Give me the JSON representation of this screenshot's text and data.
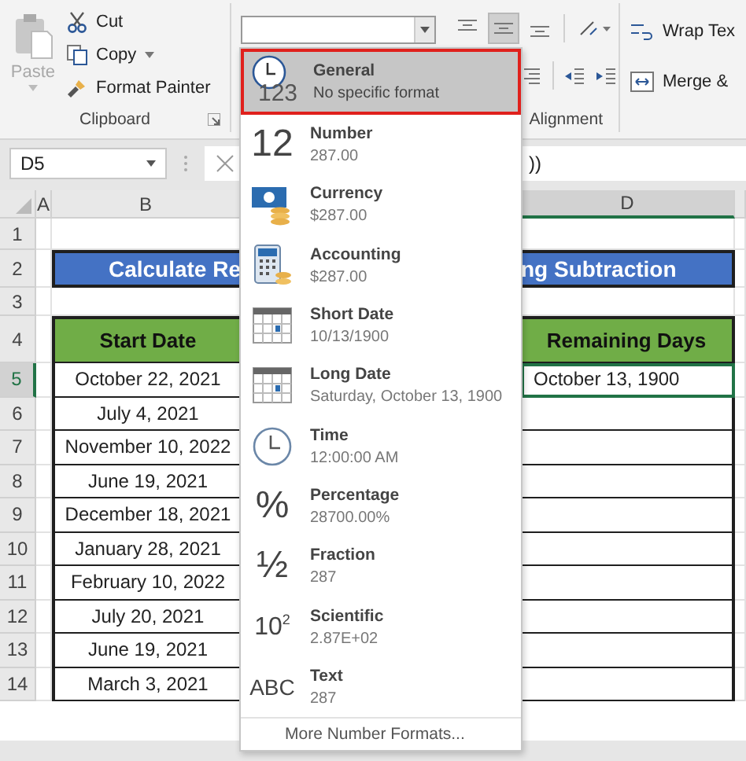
{
  "ribbon": {
    "clipboard": {
      "paste": {
        "label": "Paste",
        "disabled": true
      },
      "commands": [
        {
          "label": "Cut",
          "kind": "cut",
          "caret": false
        },
        {
          "label": "Copy",
          "kind": "copy",
          "caret": true
        },
        {
          "label": "Format Painter",
          "kind": "painter",
          "caret": false
        }
      ],
      "group_label": "Clipboard"
    },
    "alignment": {
      "vertical_buttons": [
        {
          "kind": "top",
          "selected": false
        },
        {
          "kind": "middle",
          "selected": true
        },
        {
          "kind": "bottom",
          "selected": false
        }
      ],
      "wrap_label": "Wrap Tex",
      "merge_label": "Merge &",
      "group_label": "Alignment"
    }
  },
  "formula_bar": {
    "name_box": "D5",
    "formula_visible": "))"
  },
  "columns": [
    {
      "label": "A",
      "selected": false
    },
    {
      "label": "B",
      "selected": false
    },
    {
      "label": "D",
      "selected": true
    }
  ],
  "rows": [
    {
      "number": "1",
      "selected": false
    },
    {
      "number": "2",
      "selected": false
    },
    {
      "number": "3",
      "selected": false
    },
    {
      "number": "4",
      "selected": false
    },
    {
      "number": "5",
      "selected": true
    },
    {
      "number": "6",
      "selected": false
    },
    {
      "number": "7",
      "selected": false
    },
    {
      "number": "8",
      "selected": false
    },
    {
      "number": "9",
      "selected": false
    },
    {
      "number": "10",
      "selected": false
    },
    {
      "number": "11",
      "selected": false
    },
    {
      "number": "12",
      "selected": false
    },
    {
      "number": "13",
      "selected": false
    },
    {
      "number": "14",
      "selected": false
    }
  ],
  "sheet": {
    "title_parts": [
      "Calculate Re",
      "ng Subtraction"
    ],
    "headers": [
      "Start Date",
      "Remaining Days"
    ],
    "data": [
      {
        "start": "October 22, 2021",
        "remaining": "October 13, 1900",
        "active": true
      },
      {
        "start": "July 4, 2021",
        "active": false
      },
      {
        "start": "November 10, 2022",
        "active": false
      },
      {
        "start": "June 19, 2021",
        "active": false
      },
      {
        "start": "December 18, 2021",
        "active": false
      },
      {
        "start": "January 28, 2021",
        "active": false
      },
      {
        "start": "February 10, 2022",
        "active": false
      },
      {
        "start": "July 20, 2021",
        "active": false
      },
      {
        "start": "June 19, 2021",
        "active": false
      },
      {
        "start": "March 3, 2021",
        "active": false
      }
    ]
  },
  "format_menu": {
    "items": [
      {
        "name": "General",
        "example": "No specific format",
        "kind": "general",
        "glyph": "123",
        "selected": true
      },
      {
        "name": "Number",
        "example": "287.00",
        "kind": "glyph",
        "glyph": "12",
        "selected": false
      },
      {
        "name": "Currency",
        "example": "$287.00",
        "kind": "currency",
        "selected": false
      },
      {
        "name": "Accounting",
        "example": " $287.00",
        "kind": "accounting",
        "selected": false
      },
      {
        "name": "Short Date",
        "example": "10/13/1900",
        "kind": "calendar",
        "selected": false
      },
      {
        "name": "Long Date",
        "example": "Saturday, October 13, 1900",
        "kind": "calendar",
        "selected": false
      },
      {
        "name": "Time",
        "example": "12:00:00 AM",
        "kind": "clock",
        "selected": false
      },
      {
        "name": "Percentage",
        "example": "28700.00%",
        "kind": "glyph",
        "glyph": "%",
        "selected": false
      },
      {
        "name": "Fraction",
        "example": "287",
        "kind": "glyph",
        "glyph": "½",
        "selected": false
      },
      {
        "name": "Scientific",
        "example": "2.87E+02",
        "kind": "power",
        "glyph": "10",
        "sup": "2",
        "selected": false
      },
      {
        "name": "Text",
        "example": "287",
        "kind": "abc",
        "glyph": "ABC",
        "selected": false
      }
    ],
    "more": "More Number Formats..."
  }
}
